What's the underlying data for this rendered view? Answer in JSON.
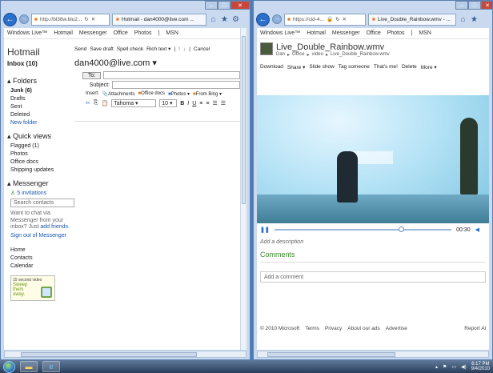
{
  "left": {
    "address": "http://bl38w.blu2...",
    "tab": "Hotmail - dan4000@live.com ...",
    "nav": [
      "Windows Live™",
      "Hotmail",
      "Messenger",
      "Office",
      "Photos",
      "|",
      "MSN"
    ],
    "app_title": "Hotmail",
    "inbox": "Inbox (10)",
    "toolbar": [
      "Send",
      "Save draft",
      "Spell check",
      "Rich text ▾",
      "|",
      "Cancel"
    ],
    "from": "dan4000@live.com ▾",
    "to_label": "To:",
    "subject_label": "Subject:",
    "insert_label": "Insert:",
    "insert_items": [
      "Attachments",
      "Office docs",
      "Photos ▾",
      "From Bing ▾"
    ],
    "font_name": "Tahoma",
    "font_size": "10",
    "folders_title": "Folders",
    "folders": [
      "Junk (6)",
      "Drafts",
      "Sent",
      "Deleted"
    ],
    "new_folder": "New folder",
    "quick_title": "Quick views",
    "quick": [
      "Flagged (1)",
      "Photos",
      "Office docs",
      "Shipping updates"
    ],
    "messenger_title": "Messenger",
    "invitations": "5 invitations",
    "search_contacts": "Search contacts",
    "chat_text": "Want to chat via Messenger from your inbox? Just",
    "add_friends": "add friends.",
    "signout": "Sign out of Messenger",
    "links": [
      "Home",
      "Contacts",
      "Calendar"
    ],
    "ad_line1": "15 second video",
    "ad_line2": "Sweep them away."
  },
  "right": {
    "address": "https://cid-4...",
    "tab": "Live_Double_Rainbow.wmv - ...",
    "nav": [
      "Windows Live™",
      "Hotmail",
      "Messenger",
      "Office",
      "Photos",
      "|",
      "MSN"
    ],
    "file_title": "Live_Double_Rainbow.wmv",
    "breadcrumb": [
      "Dan",
      "▸",
      "Office",
      "▸",
      "video",
      "▸",
      "Live_Double_Rainbow.wmv"
    ],
    "actions": [
      "Download",
      "Share ▾",
      "Slide show",
      "Tag someone",
      "That's me!",
      "Delete",
      "More ▾"
    ],
    "time": "00:30",
    "add_description": "Add a description",
    "comments_title": "Comments",
    "add_comment": "Add a comment",
    "footer": [
      "© 2010 Microsoft",
      "Terms",
      "Privacy",
      "About our ads",
      "Advertise"
    ],
    "report": "Report Al"
  },
  "taskbar": {
    "time": "6:17 PM",
    "date": "9/4/2010"
  }
}
